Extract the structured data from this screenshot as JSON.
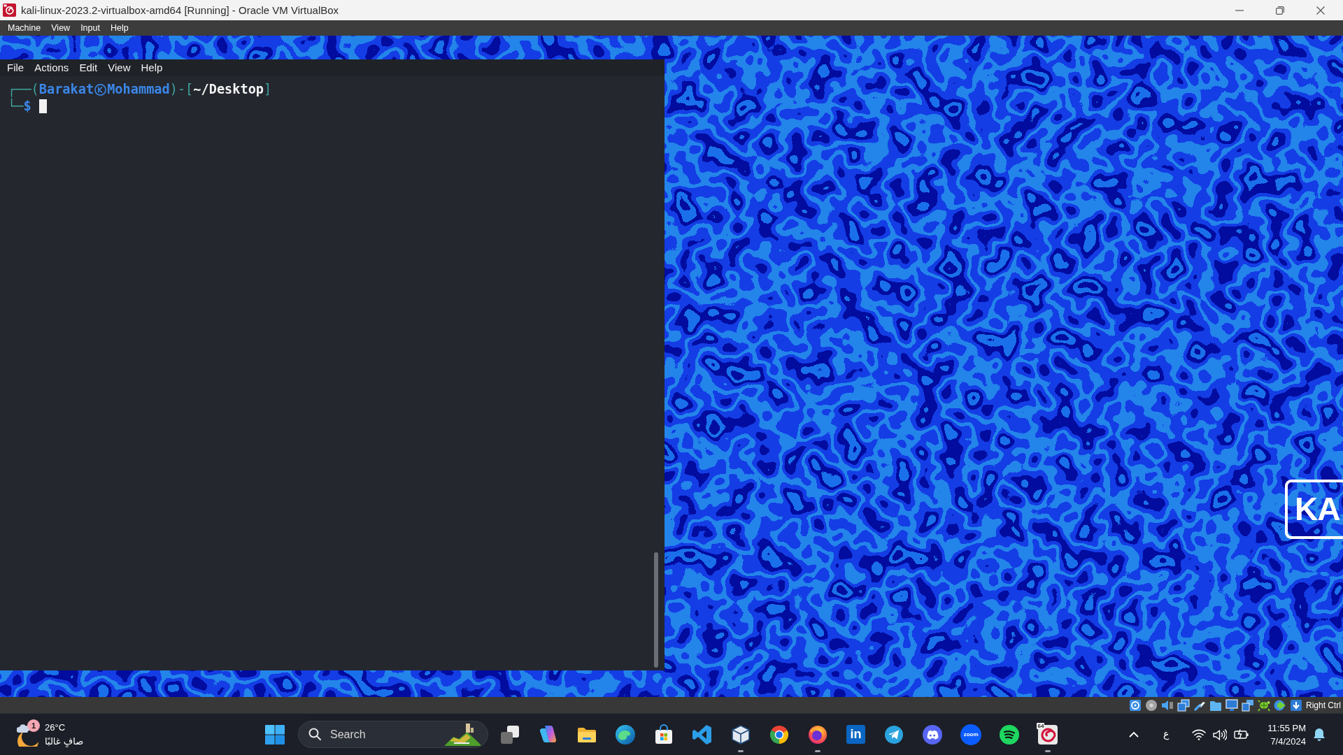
{
  "window": {
    "title": "kali-linux-2023.2-virtualbox-amd64 [Running] - Oracle VM VirtualBox"
  },
  "menu_bar": [
    "Machine",
    "View",
    "Input",
    "Help"
  ],
  "guest": {
    "terminal": {
      "menu": [
        "File",
        "Actions",
        "Edit",
        "View",
        "Help"
      ],
      "lines": [
        [
          {
            "kind": "frame",
            "text": "┌──("
          },
          {
            "kind": "user",
            "text": "Barakat"
          },
          {
            "kind": "at"
          },
          {
            "kind": "host",
            "text": "Mohammad"
          },
          {
            "kind": "frame",
            "text": ")-["
          },
          {
            "kind": "path",
            "text": "~/Desktop"
          },
          {
            "kind": "frame",
            "text": "]"
          }
        ],
        [
          {
            "kind": "frame",
            "text": "└─"
          },
          {
            "kind": "sign",
            "text": "$"
          },
          {
            "kind": "cursor"
          }
        ]
      ]
    },
    "logo": {
      "text": "KA"
    }
  },
  "status_bar": {
    "host_key": "Right Ctrl"
  },
  "taskbar": {
    "weather": {
      "badge": "1",
      "temperature": "26°C",
      "condition": "صافٍ غالبًا"
    },
    "search": {
      "placeholder": "Search"
    },
    "apps": [
      {
        "kind": "squares",
        "running": false
      },
      {
        "kind": "ribbon",
        "running": false
      },
      {
        "kind": "folder",
        "running": false
      },
      {
        "kind": "wave",
        "running": false
      },
      {
        "kind": "bag",
        "running": false
      },
      {
        "kind": "chevron",
        "running": false
      },
      {
        "kind": "cube",
        "running": true
      },
      {
        "kind": "ring",
        "running": false
      },
      {
        "kind": "flame",
        "running": true
      },
      {
        "kind": "tile",
        "text": "in",
        "running": false
      },
      {
        "kind": "plane",
        "running": false
      },
      {
        "kind": "controller",
        "running": false
      },
      {
        "kind": "disc",
        "text": "zoom",
        "running": false
      },
      {
        "kind": "stripes",
        "running": false
      },
      {
        "kind": "swirl",
        "tag": "64",
        "running": true
      }
    ],
    "tray": {
      "language": "ع",
      "time": "11:55 PM",
      "date": "7/4/2024"
    }
  }
}
